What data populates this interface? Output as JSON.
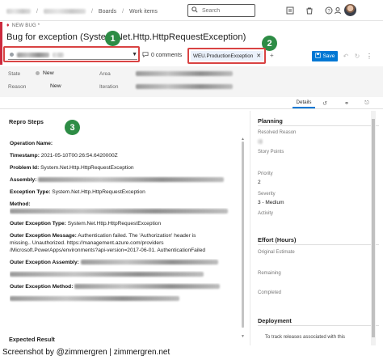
{
  "topbar": {
    "crumb_boards": "Boards",
    "crumb_sep": "/",
    "crumb_work_items": "Work items",
    "search_placeholder": "Search",
    "icons": [
      "search-icon",
      "list-icon",
      "bag-icon",
      "help-icon",
      "person-settings-icon"
    ]
  },
  "workitem": {
    "type_label": "NEW BUG *",
    "title": "Bug for exception (System.Net.Http.HttpRequestException)",
    "comments": "0 comments",
    "tag": "WEU.ProductionException",
    "add_tag": "+",
    "save_label": "Save",
    "accent_color": "#cc293d"
  },
  "annotations": {
    "badge1": "1",
    "badge2": "2",
    "badge3": "3",
    "highlight_color": "#d94343",
    "badge_color": "#2d8c45"
  },
  "fields": {
    "state_label": "State",
    "state_value": "New",
    "reason_label": "Reason",
    "reason_value": "New",
    "area_label": "Area",
    "iteration_label": "Iteration"
  },
  "tabs": {
    "details": "Details"
  },
  "repro": {
    "title": "Repro Steps",
    "op_name": "Operation Name:",
    "timestamp_label": "Timestamp:",
    "timestamp_value": "2021-05-10T00:26:54.6420000Z",
    "problem_label": "Problem Id:",
    "problem_value": "System.Net.Http.HttpRequestException",
    "assembly_label": "Assembly:",
    "exc_type_label": "Exception Type:",
    "exc_type_value": "System.Net.Http.HttpRequestException",
    "method_label": "Method:",
    "outer_type_label": "Outer Exception Type:",
    "outer_type_value": "System.Net.Http.HttpRequestException",
    "outer_msg_label": "Outer Exception Message:",
    "outer_msg_1": "Authentication failed. The 'Authorization' header is",
    "outer_msg_2": "missing.. Unauthorized. https://management.azure.com/providers",
    "outer_msg_3": "/Microsoft.PowerApps/environments?api-version=2017-06-01. AuthenticationFailed",
    "outer_assembly_label": "Outer Exception Assembly:",
    "outer_method_label": "Outer Exception Method:",
    "expected_title": "Expected Result"
  },
  "planning": {
    "title": "Planning",
    "resolved_reason": "Resolved Reason",
    "story_points": "Story Points",
    "priority_label": "Priority",
    "priority_value": "2",
    "severity_label": "Severity",
    "severity_value": "3 - Medium",
    "activity_label": "Activity"
  },
  "effort": {
    "title": "Effort (Hours)",
    "original": "Original Estimate",
    "remaining": "Remaining",
    "completed": "Completed"
  },
  "deployment": {
    "title": "Deployment",
    "text": "To track releases associated with this"
  },
  "credit": "Screenshot by @zimmergren | zimmergren.net"
}
